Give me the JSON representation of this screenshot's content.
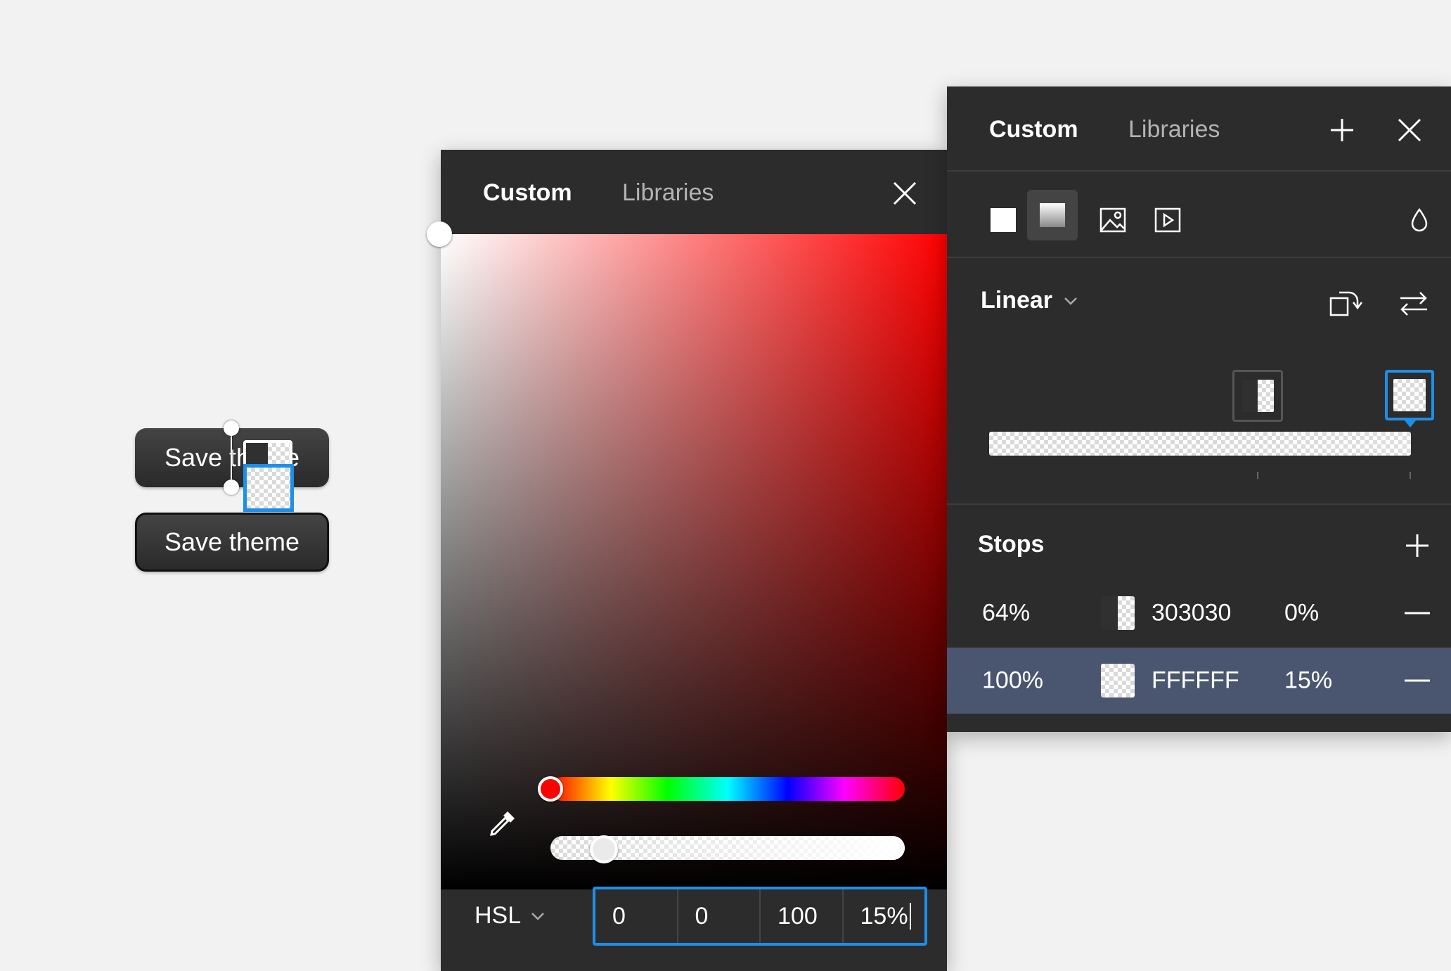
{
  "canvas": {
    "buttons": [
      {
        "label": "Save theme"
      },
      {
        "label": "Save theme"
      }
    ]
  },
  "picker": {
    "tabs": [
      {
        "label": "Custom"
      },
      {
        "label": "Libraries"
      }
    ],
    "mode": "HSL",
    "hue_position": 0.0,
    "alpha": 0.15,
    "fields": {
      "h": "0",
      "s": "0",
      "l": "100",
      "a": "15%"
    }
  },
  "fill": {
    "tabs": [
      {
        "label": "Custom"
      },
      {
        "label": "Libraries"
      }
    ],
    "gradient_type": "Linear",
    "stops_label": "Stops",
    "stops": [
      {
        "position": "64%",
        "hex": "303030",
        "opacity": "0%"
      },
      {
        "position": "100%",
        "hex": "FFFFFF",
        "opacity": "15%"
      }
    ]
  },
  "colors": {
    "accent": "#1e8fe8",
    "panel": "#2c2c2c",
    "selected_row": "#4a5670"
  }
}
